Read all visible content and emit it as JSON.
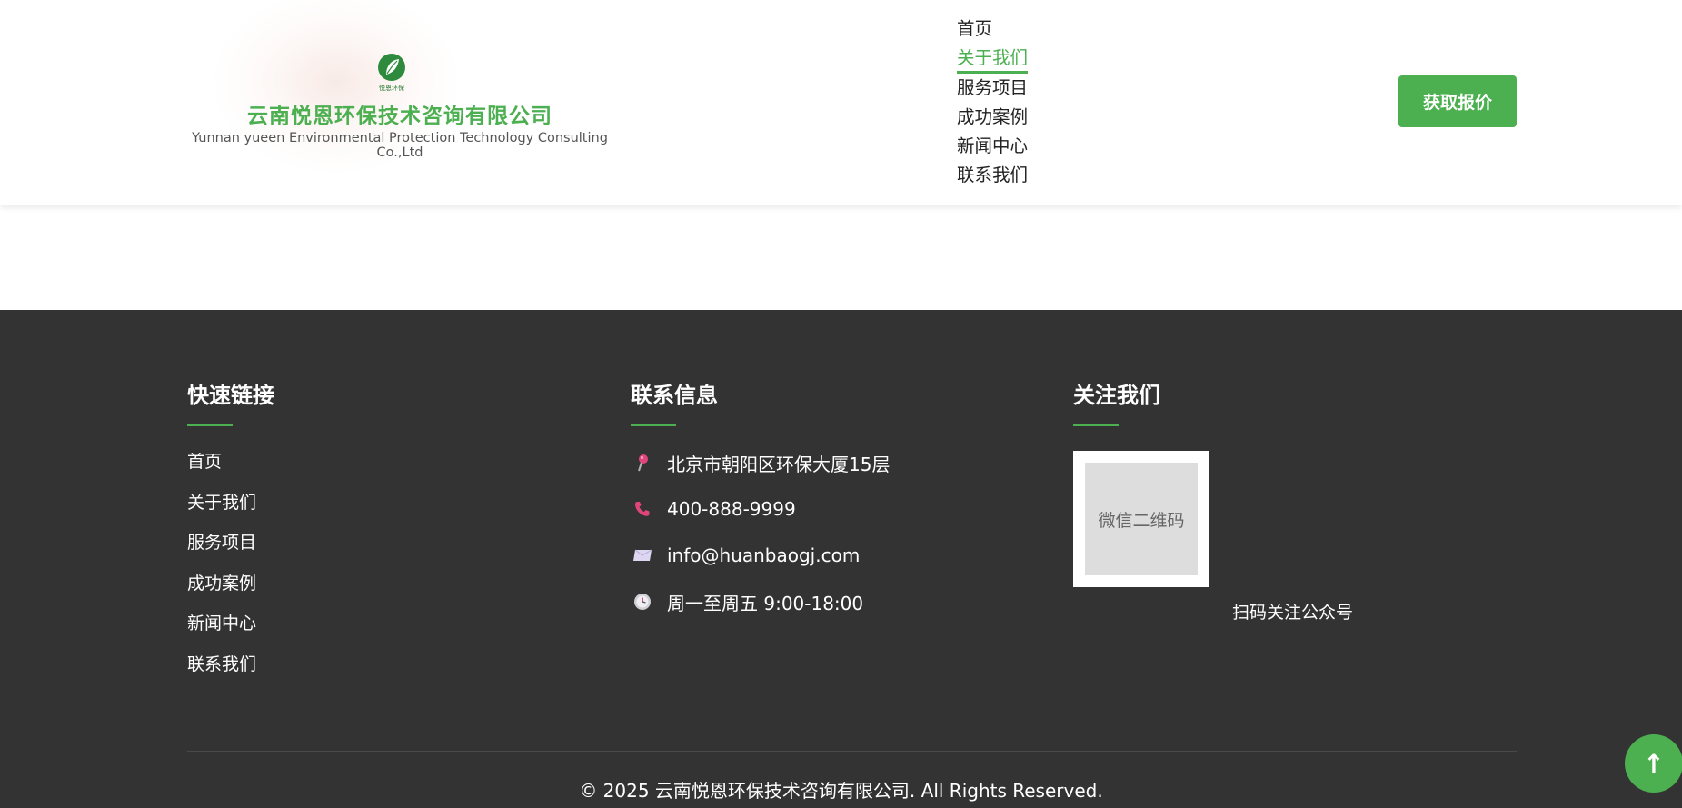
{
  "header": {
    "logo": {
      "icon": "leaf-icon",
      "mark_text": "悦恩环保",
      "company_cn": "云南悦恩环保技术咨询有限公司",
      "company_en": "Yunnan yueen Environmental Protection Technology Consulting Co.,Ltd"
    },
    "nav": [
      {
        "label": "首页",
        "active": false
      },
      {
        "label": "关于我们",
        "active": true
      },
      {
        "label": "服务项目",
        "active": false
      },
      {
        "label": "成功案例",
        "active": false
      },
      {
        "label": "新闻中心",
        "active": false
      },
      {
        "label": "联系我们",
        "active": false
      }
    ],
    "cta_label": "获取报价"
  },
  "footer": {
    "quick_links": {
      "title": "快速链接",
      "items": [
        "首页",
        "关于我们",
        "服务项目",
        "成功案例",
        "新闻中心",
        "联系我们"
      ]
    },
    "contact": {
      "title": "联系信息",
      "items": [
        {
          "icon": "map-pin-icon",
          "text": "北京市朝阳区环保大厦15层"
        },
        {
          "icon": "phone-icon",
          "text": "400-888-9999"
        },
        {
          "icon": "email-icon",
          "text": "info@huanbaogj.com"
        },
        {
          "icon": "clock-icon",
          "text": "周一至周五 9:00-18:00"
        }
      ]
    },
    "follow": {
      "title": "关注我们",
      "qr_placeholder": "微信二维码",
      "caption": "扫码关注公众号"
    },
    "copyright": "© 2025 云南悦恩环保技术咨询有限公司. All Rights Reserved."
  },
  "back_to_top": {
    "icon": "arrow-up-icon",
    "glyph": "↑"
  },
  "colors": {
    "accent": "#4caf50",
    "footer_bg": "#333333",
    "text_dark": "#222222"
  }
}
